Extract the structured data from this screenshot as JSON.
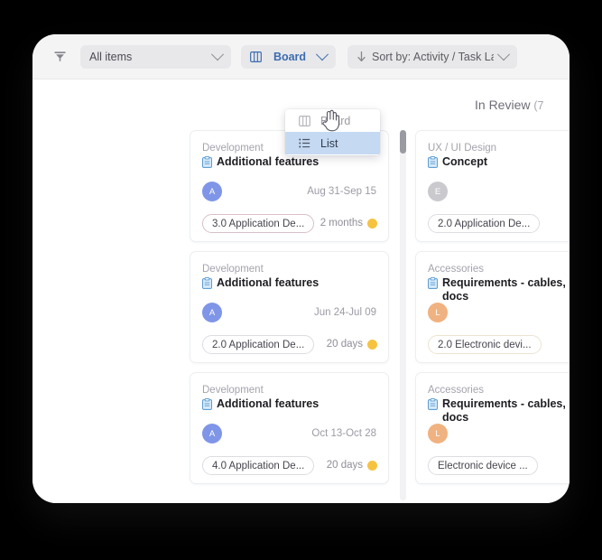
{
  "toolbar": {
    "filter_icon": "filter-funnel-icon",
    "all_items": {
      "label": "All items",
      "chevron": "chevron-down-icon"
    },
    "view_select": {
      "label": "Board",
      "icon": "board-columns-icon",
      "chevron": "chevron-down-icon"
    },
    "sort": {
      "label": "Sort by: Activity / Task La...",
      "icon": "arrow-down-icon",
      "chevron": "chevron-down-icon"
    }
  },
  "dropdown": {
    "items": [
      {
        "label": "Board",
        "icon": "board-columns-icon",
        "selected": false
      },
      {
        "label": "List",
        "icon": "list-lines-icon",
        "selected": true
      }
    ]
  },
  "board": {
    "columns": [
      {
        "header": "",
        "count": "",
        "cards": [
          {
            "category": "Development",
            "title": "Additional features",
            "icon": "clipboard-icon",
            "avatar": {
              "initial": "A",
              "color": "#7f95e8"
            },
            "dates": "Aug 31-Sep 15",
            "tag": "3.0 Application De...",
            "tag_color": "#d8bfc8",
            "duration": "2 months",
            "status_color": "#f6c341"
          },
          {
            "category": "Development",
            "title": "Additional features",
            "icon": "clipboard-icon",
            "avatar": {
              "initial": "A",
              "color": "#7f95e8"
            },
            "dates": "Jun 24-Jul 09",
            "tag": "2.0 Application De...",
            "tag_color": "#dcdce2",
            "duration": "20 days",
            "status_color": "#f6c341"
          },
          {
            "category": "Development",
            "title": "Additional features",
            "icon": "clipboard-icon",
            "avatar": {
              "initial": "A",
              "color": "#7f95e8"
            },
            "dates": "Oct 13-Oct 28",
            "tag": "4.0 Application De...",
            "tag_color": "#dcdce2",
            "duration": "20 days",
            "status_color": "#f6c341"
          }
        ]
      },
      {
        "header": "In Review",
        "count": "(7",
        "cards": [
          {
            "category": "UX / UI Design",
            "title": "Concept",
            "icon": "clipboard-icon",
            "avatar": {
              "initial": "E",
              "color": "#c9c9ce"
            },
            "dates": "",
            "tag": "2.0 Application De...",
            "tag_color": "#dcdce2",
            "duration": "",
            "status_color": ""
          },
          {
            "category": "Accessories",
            "title": "Requirements - cables, p docs",
            "icon": "clipboard-icon",
            "avatar": {
              "initial": "L",
              "color": "#f0b280"
            },
            "dates": "",
            "tag": "2.0 Electronic devi...",
            "tag_color": "#ece3d1",
            "duration": "",
            "status_color": ""
          },
          {
            "category": "Accessories",
            "title": "Requirements - cables, p docs",
            "icon": "clipboard-icon",
            "avatar": {
              "initial": "L",
              "color": "#f0b280"
            },
            "dates": "",
            "tag": "Electronic device ...",
            "tag_color": "#dcdce2",
            "duration": "",
            "status_color": ""
          }
        ]
      }
    ]
  },
  "scrollbar": {
    "name": "vertical-scrollbar"
  },
  "cursor": {
    "type": "pointer-hand-cursor"
  }
}
